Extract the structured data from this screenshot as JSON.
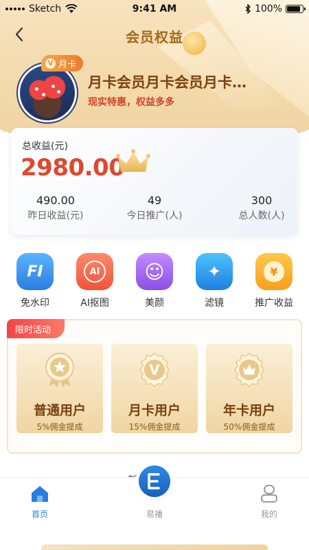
{
  "status_bar": {
    "carrier": "Sketch",
    "time": "9:41 AM",
    "battery": "100%"
  },
  "nav": {
    "title": "会员权益"
  },
  "profile": {
    "badge": "月卡",
    "name": "月卡会员月卡会员月卡…",
    "subtitle": "现实特惠，权益多多"
  },
  "earnings": {
    "label": "总收益(元)",
    "total": "2980.00",
    "stats": [
      {
        "value": "490.00",
        "label": "昨日收益(元)"
      },
      {
        "value": "49",
        "label": "今日推广(人)"
      },
      {
        "value": "300",
        "label": "总人数(人)"
      }
    ]
  },
  "features": [
    {
      "label": "免水印",
      "icon": "no-watermark-icon",
      "glyph": "FI",
      "color_from": "#5bb5ff",
      "color_to": "#2a7de1"
    },
    {
      "label": "AI抠图",
      "icon": "ai-cutout-icon",
      "glyph": "AI",
      "color_from": "#ff8a6a",
      "color_to": "#f0533a"
    },
    {
      "label": "美颜",
      "icon": "beauty-icon",
      "glyph": "☺",
      "color_from": "#c58bff",
      "color_to": "#8a4ee6"
    },
    {
      "label": "滤镜",
      "icon": "filter-wand-icon",
      "glyph": "✦",
      "color_from": "#4fc3ff",
      "color_to": "#1e7fe0"
    },
    {
      "label": "推广收益",
      "icon": "money-bag-icon",
      "glyph": "¥",
      "color_from": "#ffc94a",
      "color_to": "#f5a01a"
    }
  ],
  "promo": {
    "tag": "限时活动",
    "tiers": [
      {
        "name": "普通用户",
        "desc": "5%佣金提成",
        "icon": "star-medal-icon"
      },
      {
        "name": "月卡用户",
        "desc": "15%佣金提成",
        "icon": "v-medal-icon"
      },
      {
        "name": "年卡用户",
        "desc": "50%佣金提成",
        "icon": "crown-medal-icon"
      }
    ]
  },
  "peek_title": "新  习",
  "tabbar": {
    "items": [
      {
        "label": "首页",
        "icon": "home-icon",
        "active": true
      },
      {
        "label": "易播",
        "icon": "yibo-logo-icon",
        "active": false
      },
      {
        "label": "我的",
        "icon": "profile-icon",
        "active": false
      }
    ]
  },
  "colors": {
    "accent_gold": "#a26a1a",
    "total_red": "#e0472c",
    "active_tab": "#2a7de1",
    "inactive_tab": "#999999"
  }
}
